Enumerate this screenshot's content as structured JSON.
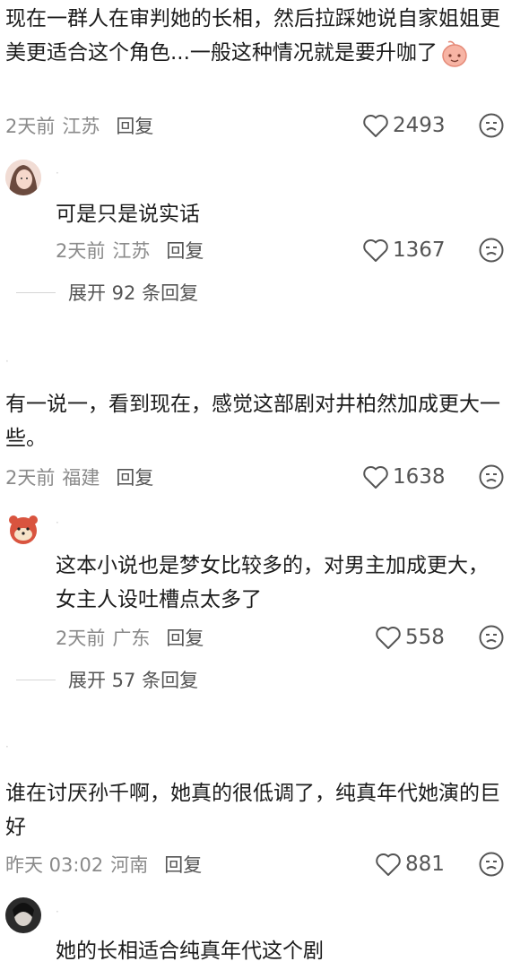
{
  "comments": [
    {
      "text": "现在一群人在审判她的长相，然后拉踩她说自家姐姐更美更适合这个角色...一般这种情况就是要升咖了",
      "time": "2天前",
      "location": "江苏",
      "reply_label": "回复",
      "likes": "2493"
    },
    {
      "text": "可是只是说实话",
      "time": "2天前",
      "location": "江苏",
      "reply_label": "回复",
      "likes": "1367",
      "expand_label": "展开 92 条回复"
    },
    {
      "text": "有一说一，看到现在，感觉这部剧对井柏然加成更大一些。",
      "time": "2天前",
      "location": "福建",
      "reply_label": "回复",
      "likes": "1638"
    },
    {
      "text": "这本小说也是梦女比较多的，对男主加成更大，女主人设吐槽点太多了",
      "time": "2天前",
      "location": "广东",
      "reply_label": "回复",
      "likes": "558",
      "expand_label": "展开 57 条回复"
    },
    {
      "text": "谁在讨厌孙千啊，她真的很低调了，纯真年代她演的巨好",
      "time": "昨天 03:02",
      "location": "河南",
      "reply_label": "回复",
      "likes": "881"
    },
    {
      "text": "她的长相适合纯真年代这个剧"
    }
  ],
  "icons": {
    "like": "heart-outline-icon",
    "dislike": "sad-face-icon",
    "inline_emoji": "peach-face-emoji"
  },
  "colors": {
    "text": "#1c1c1c",
    "meta": "#8a8a8a",
    "icon": "#555555",
    "divider": "#d6d6d6"
  }
}
